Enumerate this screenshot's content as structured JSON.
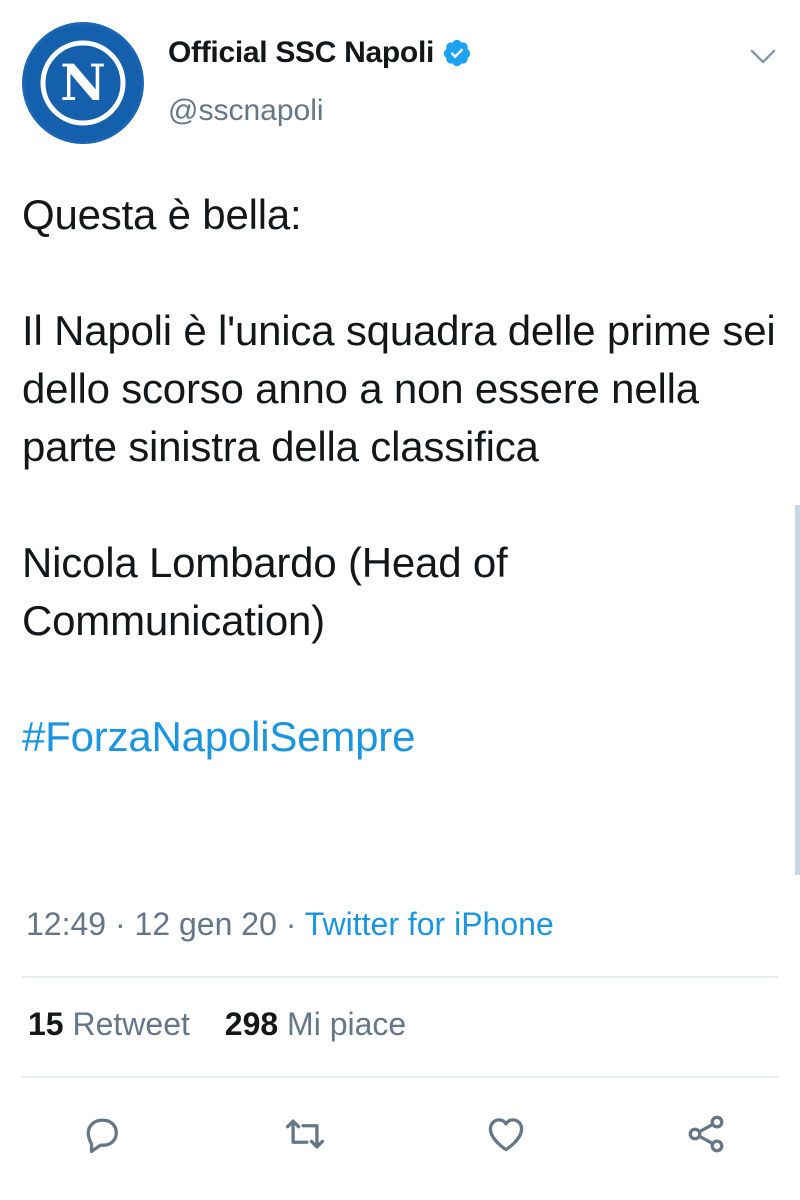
{
  "account": {
    "display_name": "Official SSC Napoli",
    "handle": "@sscnapoli",
    "avatar_letter": "N",
    "verified": true
  },
  "tweet": {
    "line_1": "Questa è bella:",
    "paragraph_2": "Il Napoli è l'unica squadra delle prime sei dello scorso anno a non essere nella parte sinistra della classifica",
    "paragraph_3": "Nicola Lombardo (Head of Communication)",
    "hashtag": "#ForzaNapoliSempre"
  },
  "meta": {
    "time": "12:49",
    "separator": "·",
    "date": "12 gen 20",
    "source": "Twitter for iPhone"
  },
  "stats": {
    "retweets_count": "15",
    "retweets_label": "Retweet",
    "likes_count": "298",
    "likes_label": "Mi piace"
  },
  "icons": {
    "reply": "reply-icon",
    "retweet": "retweet-icon",
    "like": "heart-icon",
    "share": "share-icon",
    "menu": "chevron-down-icon",
    "verified": "verified-badge-icon"
  },
  "colors": {
    "link": "#1b95e0",
    "text": "#14171a",
    "secondary": "#657786",
    "divider": "#e6ecf0",
    "avatar_bg": "#1b66b4"
  }
}
